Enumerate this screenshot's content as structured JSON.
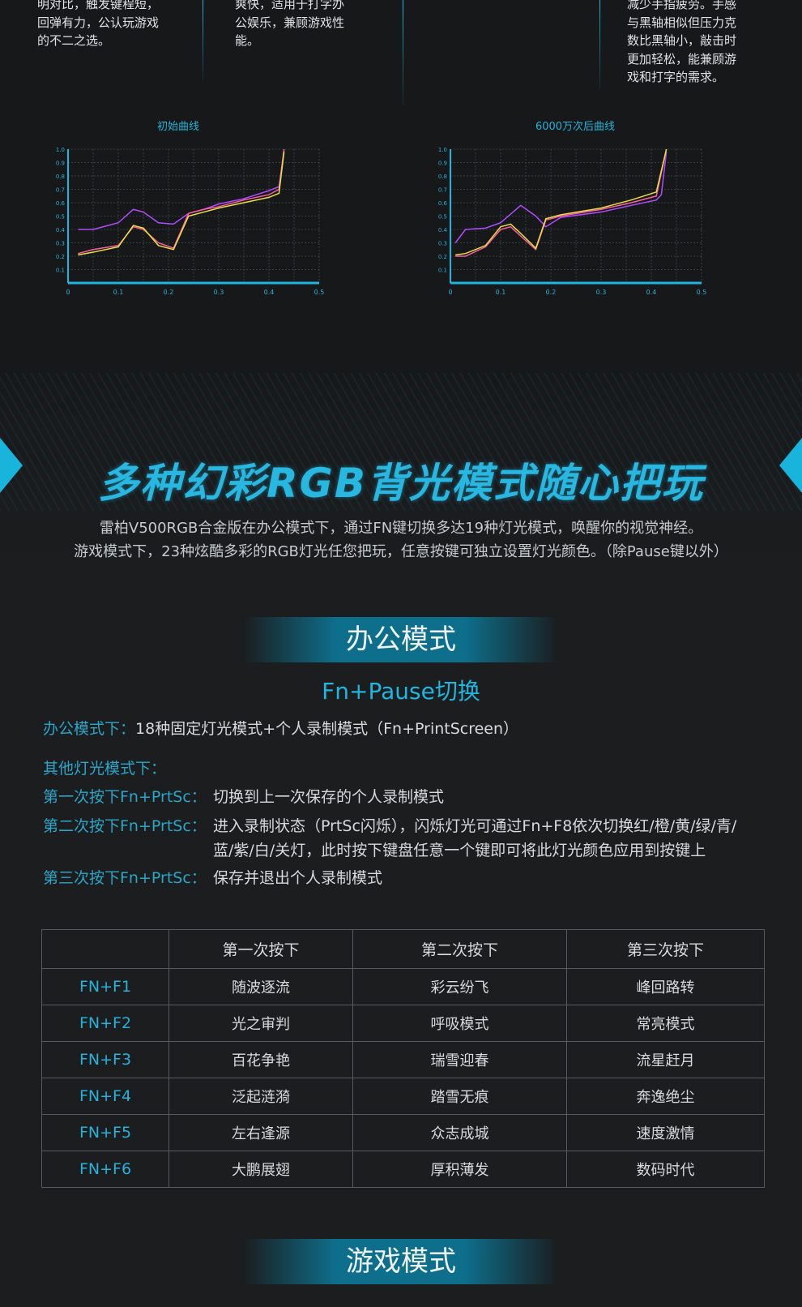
{
  "top_descs": [
    {
      "lines": [
        "明对比，触发键程短，",
        "回弹有力，公认玩游戏",
        "的不二之选。"
      ]
    },
    {
      "lines": [
        "爽快，适用于打字办",
        "公娱乐，兼顾游戏性",
        "能。"
      ]
    },
    {
      "lines": [
        "减少手指疲劳。手感",
        "与黑轴相似但压力克",
        "数比黑轴小，敲击时",
        "更加轻松，能兼顾游",
        "戏和打字的需求。"
      ]
    }
  ],
  "chart_data": [
    {
      "type": "line",
      "title": "初始曲线",
      "xlim": [
        0,
        0.5
      ],
      "ylim": [
        0,
        1.0
      ],
      "x_ticks": [
        "0",
        "0.1",
        "0.2",
        "0.3",
        "0.4",
        "0.5"
      ],
      "y_ticks": [
        "0.1",
        "0.2",
        "0.3",
        "0.4",
        "0.5",
        "0.6",
        "0.7",
        "0.8",
        "0.9",
        "1.0"
      ],
      "grid": true,
      "series": [
        {
          "color": "#b04cff",
          "x": [
            0.02,
            0.05,
            0.1,
            0.13,
            0.15,
            0.18,
            0.21,
            0.24,
            0.27,
            0.3,
            0.35,
            0.4,
            0.42,
            0.43
          ],
          "y": [
            0.4,
            0.4,
            0.45,
            0.55,
            0.53,
            0.45,
            0.44,
            0.52,
            0.55,
            0.59,
            0.63,
            0.69,
            0.72,
            0.99
          ]
        },
        {
          "color": "#ff5fa0",
          "x": [
            0.02,
            0.05,
            0.1,
            0.13,
            0.15,
            0.18,
            0.21,
            0.24,
            0.27,
            0.3,
            0.35,
            0.4,
            0.42,
            0.43
          ],
          "y": [
            0.22,
            0.25,
            0.28,
            0.42,
            0.4,
            0.3,
            0.26,
            0.52,
            0.55,
            0.57,
            0.62,
            0.66,
            0.7,
            1.0
          ]
        },
        {
          "color": "#e8e040",
          "x": [
            0.02,
            0.05,
            0.1,
            0.13,
            0.15,
            0.18,
            0.21,
            0.24,
            0.27,
            0.3,
            0.35,
            0.4,
            0.42,
            0.43
          ],
          "y": [
            0.21,
            0.23,
            0.27,
            0.43,
            0.41,
            0.28,
            0.25,
            0.5,
            0.53,
            0.56,
            0.6,
            0.64,
            0.67,
            0.98
          ]
        }
      ]
    },
    {
      "type": "line",
      "title": "6000万次后曲线",
      "xlim": [
        0,
        0.5
      ],
      "ylim": [
        0,
        1.0
      ],
      "x_ticks": [
        "0",
        "0.1",
        "0.2",
        "0.3",
        "0.4",
        "0.5"
      ],
      "y_ticks": [
        "0.1",
        "0.2",
        "0.3",
        "0.4",
        "0.5",
        "0.6",
        "0.7",
        "0.8",
        "0.9",
        "1.0"
      ],
      "grid": true,
      "series": [
        {
          "color": "#b04cff",
          "x": [
            0.01,
            0.03,
            0.07,
            0.1,
            0.14,
            0.17,
            0.19,
            0.22,
            0.3,
            0.36,
            0.41,
            0.42,
            0.43
          ],
          "y": [
            0.3,
            0.4,
            0.41,
            0.45,
            0.58,
            0.5,
            0.42,
            0.49,
            0.53,
            0.58,
            0.62,
            0.66,
            0.98
          ]
        },
        {
          "color": "#ff5fa0",
          "x": [
            0.01,
            0.03,
            0.07,
            0.1,
            0.12,
            0.14,
            0.17,
            0.19,
            0.22,
            0.3,
            0.36,
            0.41,
            0.43
          ],
          "y": [
            0.2,
            0.2,
            0.27,
            0.4,
            0.42,
            0.35,
            0.25,
            0.47,
            0.5,
            0.55,
            0.6,
            0.65,
            1.0
          ]
        },
        {
          "color": "#e8e040",
          "x": [
            0.01,
            0.03,
            0.07,
            0.1,
            0.12,
            0.14,
            0.17,
            0.19,
            0.22,
            0.3,
            0.36,
            0.41,
            0.43
          ],
          "y": [
            0.21,
            0.22,
            0.28,
            0.42,
            0.44,
            0.37,
            0.26,
            0.48,
            0.51,
            0.56,
            0.62,
            0.68,
            1.0
          ]
        }
      ]
    }
  ],
  "headline": "多种幻彩RGB背光模式随心把玩",
  "intro": [
    "雷柏V500RGB合金版在办公模式下，通过FN键切换多达19种灯光模式，唤醒你的视觉神经。",
    "游戏模式下，23种炫酷多彩的RGB灯光任您把玩，任意按键可独立设置灯光颜色。（除Pause键以外）"
  ],
  "office": {
    "title": "办公模式",
    "switch": "Fn+Pause切换",
    "line1_key": "办公模式下：",
    "line1_val": "18种固定灯光模式+个人录制模式（Fn+PrintScreen）",
    "other_label": "其他灯光模式下：",
    "steps": [
      {
        "key": "第一次按下Fn+PrtSc：",
        "val": "切换到上一次保存的个人录制模式"
      },
      {
        "key": "第二次按下Fn+PrtSc：",
        "val": "进入录制状态（PrtSc闪烁），闪烁灯光可通过Fn+F8依次切换红/橙/黄/绿/青/",
        "val2": "蓝/紫/白/关灯，此时按下键盘任意一个键即可将此灯光颜色应用到按键上"
      },
      {
        "key": "第三次按下Fn+PrtSc：",
        "val": "保存并退出个人录制模式"
      }
    ]
  },
  "table": {
    "headers": [
      "",
      "第一次按下",
      "第二次按下",
      "第三次按下"
    ],
    "rows": [
      [
        "FN+F1",
        "随波逐流",
        "彩云纷飞",
        "峰回路转"
      ],
      [
        "FN+F2",
        "光之审判",
        "呼吸模式",
        "常亮模式"
      ],
      [
        "FN+F3",
        "百花争艳",
        "瑞雪迎春",
        "流星赶月"
      ],
      [
        "FN+F4",
        "泛起涟漪",
        "踏雪无痕",
        "奔逸绝尘"
      ],
      [
        "FN+F5",
        "左右逢源",
        "众志成城",
        "速度激情"
      ],
      [
        "FN+F6",
        "大鹏展翅",
        "厚积薄发",
        "数码时代"
      ]
    ]
  },
  "game": {
    "title": "游戏模式"
  }
}
